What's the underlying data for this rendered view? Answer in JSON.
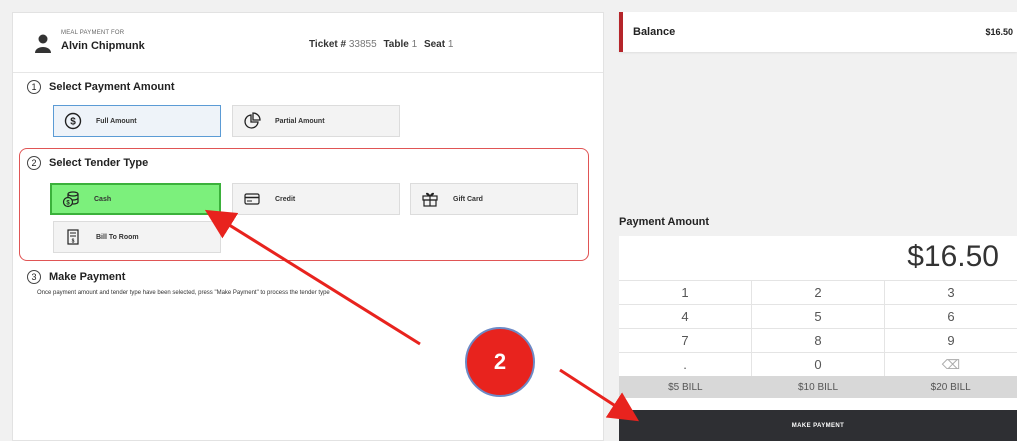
{
  "header": {
    "meal_payment_for": "MEAL PAYMENT FOR",
    "customer_name": "Alvin Chipmunk",
    "ticket_label": "Ticket #",
    "ticket_value": "33855",
    "table_label": "Table",
    "table_value": "1",
    "seat_label": "Seat",
    "seat_value": "1"
  },
  "step1": {
    "num": "1",
    "title": "Select Payment Amount",
    "full_amount": "Full Amount",
    "partial_amount": "Partial Amount"
  },
  "step2": {
    "num": "2",
    "title": "Select Tender Type",
    "cash": "Cash",
    "credit": "Credit",
    "gift_card": "Gift Card",
    "bill_to_room": "Bill To Room"
  },
  "step3": {
    "num": "3",
    "title": "Make Payment",
    "instructions": "Once payment amount and tender type have been selected, press \"Make Payment\" to process the tender type"
  },
  "balance": {
    "label": "Balance",
    "value": "$16.50"
  },
  "payment": {
    "label": "Payment Amount",
    "display": "$16.50",
    "keys": [
      [
        "1",
        "2",
        "3"
      ],
      [
        "4",
        "5",
        "6"
      ],
      [
        "7",
        "8",
        "9"
      ],
      [
        ".",
        "0",
        "⌫"
      ]
    ],
    "bills": [
      "$5 BILL",
      "$10 BILL",
      "$20 BILL"
    ],
    "make_payment": "MAKE PAYMENT"
  },
  "annotation": {
    "badge": "2",
    "color": "#e8231e"
  },
  "icons": [
    "user-icon",
    "dollar-circle-icon",
    "pie-chart-icon",
    "cash-coins-icon",
    "credit-card-icon",
    "gift-icon",
    "bill-room-icon",
    "backspace-icon"
  ]
}
